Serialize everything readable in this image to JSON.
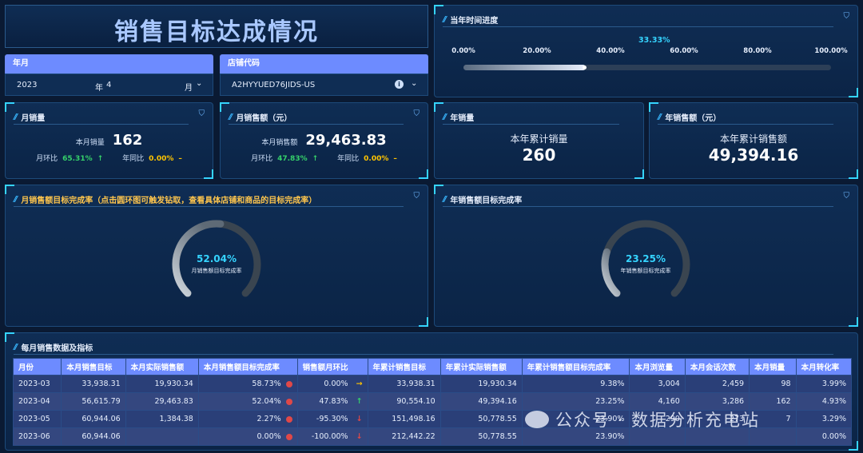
{
  "title": "销售目标达成情况",
  "filters": {
    "month": {
      "label": "年月",
      "year": "2023",
      "year_unit": "年",
      "month": "4",
      "month_unit": "月"
    },
    "store": {
      "label": "店铺代码",
      "value": "A2HYYUED76JIDS-US"
    }
  },
  "time_progress": {
    "title": "当年时间进度",
    "value_label": "33.33%",
    "value": 0.3333,
    "ticks": [
      "0.00%",
      "20.00%",
      "40.00%",
      "60.00%",
      "80.00%",
      "100.00%"
    ]
  },
  "monthly_sales": {
    "title": "月销量",
    "label": "本月销量",
    "value": "162",
    "mom_label": "月环比",
    "mom": "65.31%",
    "yoy_label": "年同比",
    "yoy": "0.00%"
  },
  "monthly_amount": {
    "title": "月销售额（元）",
    "label": "本月销售额",
    "value": "29,463.83",
    "mom_label": "月环比",
    "mom": "47.83%",
    "yoy_label": "年同比",
    "yoy": "0.00%"
  },
  "year_sales": {
    "title": "年销量",
    "label": "本年累计销量",
    "value": "260"
  },
  "year_amount": {
    "title": "年销售额（元）",
    "label": "本年累计销售额",
    "value": "49,394.16"
  },
  "month_gauge": {
    "title": "月销售额目标完成率（点击圆环图可触发钻取，查看具体店铺和商品的目标完成率）",
    "value_label": "52.04%",
    "value": 0.5204,
    "caption": "月销售额目标完成率"
  },
  "year_gauge": {
    "title": "年销售额目标完成率",
    "value_label": "23.25%",
    "value": 0.2325,
    "caption": "年销售额目标完成率"
  },
  "table": {
    "title": "每月销售数据及指标",
    "headers": [
      "月份",
      "本月销售目标",
      "本月实际销售额",
      "本月销售额目标完成率",
      "销售额月环比",
      "年累计销售目标",
      "年累计实际销售额",
      "年累计销售额目标完成率",
      "本月浏览量",
      "本月会话次数",
      "本月销量",
      "本月转化率"
    ],
    "rows": [
      [
        "2023-03",
        "33,938.31",
        "19,930.34",
        "58.73%",
        "0.00%",
        "33,938.31",
        "19,930.34",
        "9.38%",
        "3,004",
        "2,459",
        "98",
        "3.99%"
      ],
      [
        "2023-04",
        "56,615.79",
        "29,463.83",
        "52.04%",
        "47.83%",
        "90,554.10",
        "49,394.16",
        "23.25%",
        "4,160",
        "3,286",
        "162",
        "4.93%"
      ],
      [
        "2023-05",
        "60,944.06",
        "1,384.38",
        "2.27%",
        "-95.30%",
        "151,498.16",
        "50,778.55",
        "23.90%",
        "290",
        "273",
        "7",
        "3.29%"
      ],
      [
        "2023-06",
        "60,944.06",
        "",
        "0.00%",
        "-100.00%",
        "212,442.22",
        "50,778.55",
        "23.90%",
        "",
        "",
        "",
        "0.00%"
      ]
    ],
    "trend_icons": [
      "arrow-right-icon",
      "arrow-up-icon",
      "arrow-down-icon",
      "arrow-down-icon"
    ]
  },
  "watermark": "公众号 · 数据分析充电站",
  "colors": {
    "accent": "#6d8bff",
    "cyan": "#35d4ff",
    "green": "#35d06a",
    "yellow": "#ffc400",
    "red": "#e04848"
  }
}
